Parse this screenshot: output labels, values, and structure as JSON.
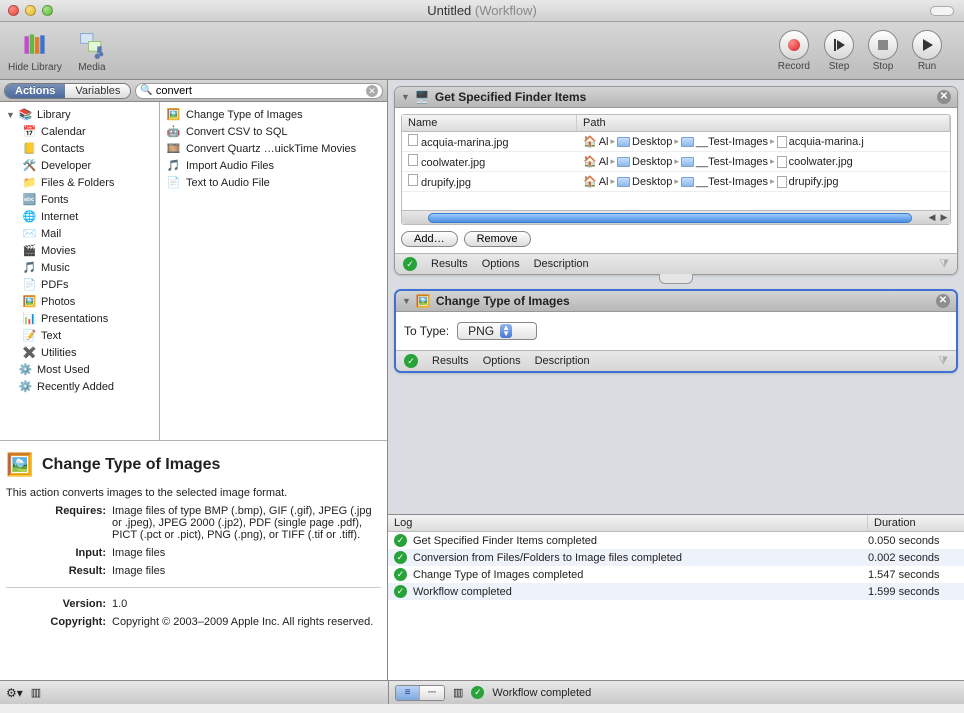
{
  "window": {
    "title": "Untitled",
    "subtitle": "(Workflow)"
  },
  "toolbar": {
    "hideLibrary": "Hide Library",
    "media": "Media",
    "record": "Record",
    "step": "Step",
    "stop": "Stop",
    "run": "Run"
  },
  "leftHead": {
    "tabActions": "Actions",
    "tabVariables": "Variables",
    "searchValue": "convert"
  },
  "library": {
    "root": "Library",
    "items": [
      "Calendar",
      "Contacts",
      "Developer",
      "Files & Folders",
      "Fonts",
      "Internet",
      "Mail",
      "Movies",
      "Music",
      "PDFs",
      "Photos",
      "Presentations",
      "Text",
      "Utilities"
    ],
    "mostUsed": "Most Used",
    "recentlyAdded": "Recently Added"
  },
  "actions": [
    "Change Type of Images",
    "Convert CSV to SQL",
    "Convert Quartz …uickTime Movies",
    "Import Audio Files",
    "Text to Audio File"
  ],
  "desc": {
    "title": "Change Type of Images",
    "summary": "This action converts images to the selected image format.",
    "requiresLabel": "Requires:",
    "requires": "Image files of type BMP (.bmp), GIF (.gif), JPEG (.jpg or .jpeg), JPEG 2000 (.jp2), PDF (single page .pdf), PICT (.pct or .pict), PNG (.png), or TIFF (.tif or .tiff).",
    "inputLabel": "Input:",
    "input": "Image files",
    "resultLabel": "Result:",
    "result": "Image files",
    "versionLabel": "Version:",
    "version": "1.0",
    "copyrightLabel": "Copyright:",
    "copyright": "Copyright © 2003–2009 Apple Inc.  All rights reserved."
  },
  "card1": {
    "title": "Get Specified Finder Items",
    "colName": "Name",
    "colPath": "Path",
    "rows": [
      {
        "name": "acquia-marina.jpg",
        "home": "Al",
        "p1": "Desktop",
        "p2": "__Test-Images",
        "file": "acquia-marina.j"
      },
      {
        "name": "coolwater.jpg",
        "home": "Al",
        "p1": "Desktop",
        "p2": "__Test-Images",
        "file": "coolwater.jpg"
      },
      {
        "name": "drupify.jpg",
        "home": "Al",
        "p1": "Desktop",
        "p2": "__Test-Images",
        "file": "drupify.jpg"
      }
    ],
    "add": "Add…",
    "remove": "Remove",
    "results": "Results",
    "options": "Options",
    "description": "Description"
  },
  "card2": {
    "title": "Change Type of Images",
    "toTypeLabel": "To Type:",
    "toTypeValue": "PNG",
    "results": "Results",
    "options": "Options",
    "description": "Description"
  },
  "log": {
    "colLog": "Log",
    "colDuration": "Duration",
    "rows": [
      {
        "msg": "Get Specified Finder Items completed",
        "dur": "0.050 seconds"
      },
      {
        "msg": "Conversion from Files/Folders to Image files completed",
        "dur": "0.002 seconds"
      },
      {
        "msg": "Change Type of Images completed",
        "dur": "1.547 seconds"
      },
      {
        "msg": "Workflow completed",
        "dur": "1.599 seconds"
      }
    ]
  },
  "status": {
    "msg": "Workflow completed"
  }
}
